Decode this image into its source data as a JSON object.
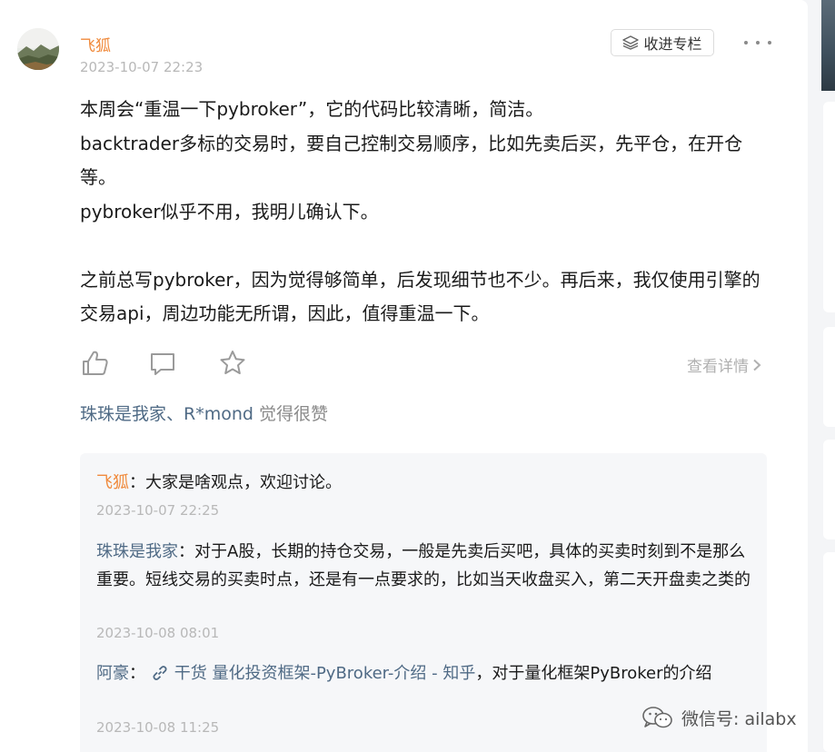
{
  "post": {
    "author": "飞狐",
    "time": "2023-10-07 22:23",
    "collect_label": "收进专栏",
    "body": [
      "本周会“重温一下pybroker”，它的代码比较清晰，简洁。",
      "backtrader多标的交易时，要自己控制交易顺序，比如先卖后买，先平仓，在开仓等。",
      "pybroker似乎不用，我明儿确认下。",
      "",
      "之前总写pybroker，因为觉得够简单，后发现细节也不少。再后来，我仅使用引擎的交易api，周边功能无所谓，因此，值得重温一下。"
    ],
    "detail_label": "查看详情",
    "likes": {
      "names": "珠珠是我家、R*mond",
      "suffix": " 觉得很赞"
    }
  },
  "comments": [
    {
      "user": "飞狐",
      "sep": "：",
      "text": "大家是啥观点，欢迎讨论。",
      "time": "2023-10-07 22:25"
    },
    {
      "user": "珠珠是我家",
      "sep": "：",
      "text": "对于A股，长期的持仓交易，一般是先卖后买吧，具体的买卖时刻到不是那么重要。短线交易的买卖时点，还是有一点要求的，比如当天收盘买入，第二天开盘卖之类的",
      "time": "2023-10-08 08:01"
    },
    {
      "user": "阿豪",
      "sep": "： ",
      "link": "干货 量化投资框架-PyBroker-介绍 - 知乎",
      "text": "，对于量化框架PyBroker的介绍",
      "time": "2023-10-08 11:25"
    }
  ],
  "watermark": "微信号: ailabx",
  "icons": {
    "like": "thumbs-up-icon",
    "comment": "comment-icon",
    "star": "star-icon",
    "more": "more-icon",
    "collect": "stack-icon",
    "link": "link-icon",
    "wechat": "wechat-icon"
  },
  "colors": {
    "author": "#f08a3c",
    "user_link": "#4f6a85",
    "muted": "#b8b8b8"
  }
}
